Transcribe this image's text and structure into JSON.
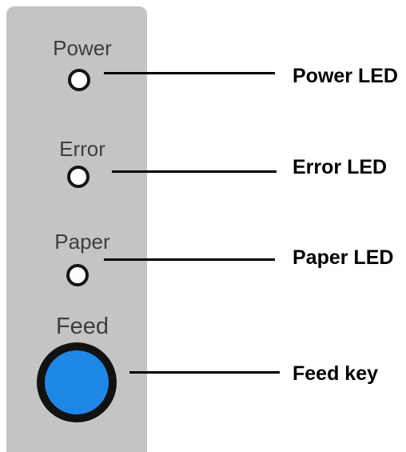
{
  "panel": {
    "labels": {
      "power": "Power",
      "error": "Error",
      "paper": "Paper",
      "feed": "Feed"
    },
    "colors": {
      "panel": "#c2c4c5",
      "led_fill": "#ffffff",
      "led_ring": "#151515",
      "feed_key": "#1f88e6"
    }
  },
  "callouts": {
    "power_led": "Power LED",
    "error_led": "Error LED",
    "paper_led": "Paper LED",
    "feed_key": "Feed key"
  }
}
